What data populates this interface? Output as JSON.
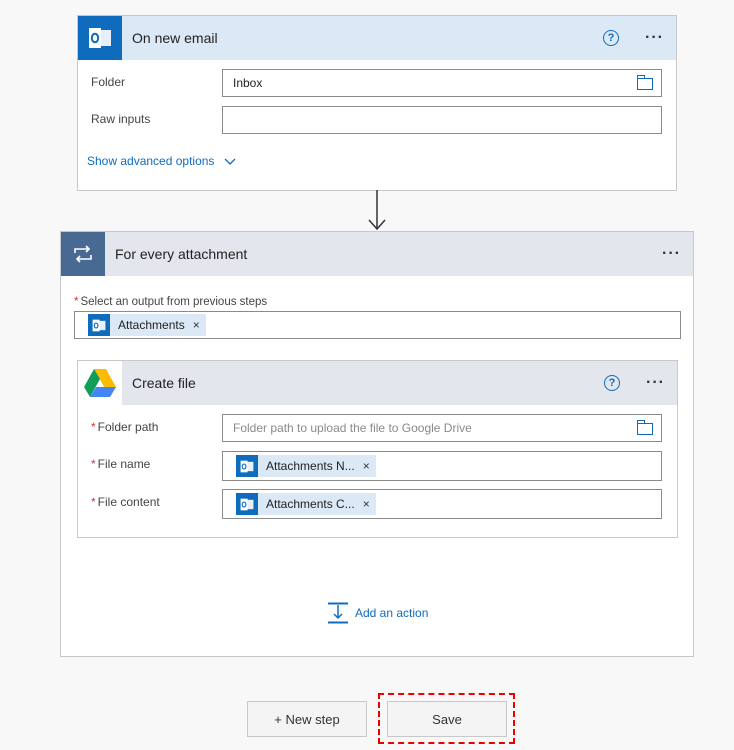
{
  "trigger": {
    "title": "On new email",
    "help": "?",
    "more": "···",
    "folder_label": "Folder",
    "folder_value": "Inbox",
    "raw_label": "Raw inputs",
    "raw_value": "",
    "advanced": "Show advanced options"
  },
  "loop": {
    "title": "For every attachment",
    "more": "···",
    "req": "*",
    "select_label": "Select an output from previous steps",
    "token": "Attachments",
    "token_x": "×"
  },
  "drive": {
    "title": "Create file",
    "help": "?",
    "more": "···",
    "req": "*",
    "folder_label": "Folder path",
    "folder_placeholder": "Folder path to upload the file to Google Drive",
    "name_label": "File name",
    "name_token": "Attachments N...",
    "content_label": "File content",
    "content_token": "Attachments C...",
    "token_x": "×"
  },
  "add_action": "Add an action",
  "footer": {
    "new_step": "+ New step",
    "save": "Save"
  },
  "colors": {
    "accent": "#0f6cbd",
    "loop": "#486991",
    "required": "#d13438",
    "highlight": "#ee0000"
  }
}
